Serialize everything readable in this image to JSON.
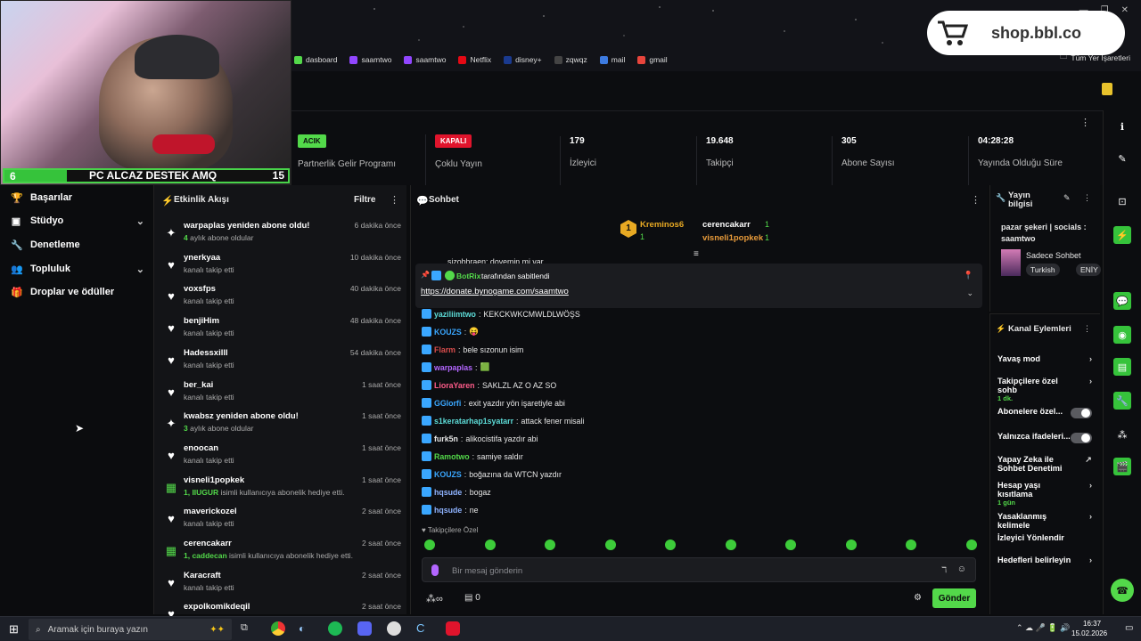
{
  "browser": {
    "bookmarks": [
      {
        "label": "dasboard",
        "color": "#53d94a"
      },
      {
        "label": "saamtwo",
        "color": "#9146ff"
      },
      {
        "label": "saamtwo",
        "color": "#9146ff"
      },
      {
        "label": "Netflix",
        "color": "#e50914"
      },
      {
        "label": "disney+",
        "color": "#1a3a8f"
      },
      {
        "label": "zqwqz",
        "color": "#444"
      },
      {
        "label": "mail",
        "color": "#3d7be0"
      },
      {
        "label": "gmail",
        "color": "#e8453c"
      }
    ],
    "all_bookmarks": "Tüm Yer İşaretleri",
    "shop_text": "shop.bbl.co"
  },
  "overlay": {
    "left": "6",
    "text": "PC ALCAZ DESTEK AMQ",
    "right": "15"
  },
  "stats": [
    {
      "badge": "ACIK",
      "badge_color": "#53d94a",
      "label": "Partnerlik Gelir Programı"
    },
    {
      "badge": "KAPALI",
      "badge_color": "#e0142c",
      "label": "Çoklu Yayın"
    },
    {
      "value": "179",
      "label": "İzleyici"
    },
    {
      "value": "19.648",
      "label": "Takipçi"
    },
    {
      "value": "305",
      "label": "Abone Sayısı"
    },
    {
      "value": "04:28:28",
      "label": "Yayında Olduğu Süre"
    }
  ],
  "nav": [
    {
      "label": "Başarılar",
      "icon": "trophy-icon"
    },
    {
      "label": "Stüdyo",
      "icon": "camera-icon",
      "chevron": true
    },
    {
      "label": "Denetleme",
      "icon": "wrench-icon"
    },
    {
      "label": "Topluluk",
      "icon": "users-icon",
      "chevron": true
    },
    {
      "label": "Droplar ve ödüller",
      "icon": "gift-icon"
    }
  ],
  "activity": {
    "title": "Etkinlik Akışı",
    "filter": "Filtre",
    "items": [
      {
        "name": "warpaplas yeniden abone oldu!",
        "sub_hl": "4",
        "sub": " aylık abone oldular",
        "time": "6 dakika önce",
        "icon": "star"
      },
      {
        "name": "ynerkyaa",
        "sub": "kanalı takip etti",
        "time": "10 dakika önce",
        "icon": "heart"
      },
      {
        "name": "voxsfps",
        "sub": "kanalı takip etti",
        "time": "40 dakika önce",
        "icon": "heart"
      },
      {
        "name": "benjiHim",
        "sub": "kanalı takip etti",
        "time": "48 dakika önce",
        "icon": "heart"
      },
      {
        "name": "Hadessxilll",
        "sub": "kanalı takip etti",
        "time": "54 dakika önce",
        "icon": "heart"
      },
      {
        "name": "ber_kai",
        "sub": "kanalı takip etti",
        "time": "1 saat önce",
        "icon": "heart"
      },
      {
        "name": "kwabsz yeniden abone oldu!",
        "sub_hl": "3",
        "sub": " aylık abone oldular",
        "time": "1 saat önce",
        "icon": "star"
      },
      {
        "name": "enoocan",
        "sub": "kanalı takip etti",
        "time": "1 saat önce",
        "icon": "heart"
      },
      {
        "name": "visneli1popkek",
        "sub_hl": "1, IIUGUR",
        "sub": " isimli kullanıcıya abonelik hediye etti.",
        "time": "1 saat önce",
        "icon": "gift"
      },
      {
        "name": "maverickozel",
        "sub": "kanalı takip etti",
        "time": "2 saat önce",
        "icon": "heart"
      },
      {
        "name": "cerencakarr",
        "sub_hl": "1, caddecan",
        "sub": " isimli kullanıcıya abonelik hediye etti.",
        "time": "2 saat önce",
        "icon": "gift"
      },
      {
        "name": "Karacraft",
        "sub": "kanalı takip etti",
        "time": "2 saat önce",
        "icon": "heart"
      },
      {
        "name": "expolkomikdeqil",
        "sub": "",
        "time": "2 saat önce",
        "icon": "heart"
      }
    ]
  },
  "chat": {
    "title": "Sohbet",
    "leaderboard": [
      {
        "rank": "1",
        "name": "Kreminos6",
        "count": "1",
        "sub": "1"
      },
      {
        "name": "cerencakarr",
        "count": "1"
      },
      {
        "name": "visneli1popkek",
        "count": "1"
      }
    ],
    "partial_top": "sizobhraen: dovemin mi var",
    "pinned": {
      "by": "BotRix",
      "suffix": "tarafından sabitlendi",
      "link": "https://donate.bynogame.com/saamtwo"
    },
    "messages": [
      {
        "user": "yaziliimtwo",
        "color": "#5ddcd8",
        "text": "KEKCKWKCMWLDLWÖŞS"
      },
      {
        "user": "KOUZS",
        "color": "#3aa7ff",
        "text": "😝"
      },
      {
        "user": "Flarm",
        "color": "#d94d4d",
        "text": "bele sızonun isim"
      },
      {
        "user": "warpaplas",
        "color": "#b366ff",
        "text": "🟩"
      },
      {
        "user": "LioraYaren",
        "color": "#ff5c8a",
        "text": "SAKLZL AZ O AZ SO"
      },
      {
        "user": "GGlorfi",
        "color": "#3aa7ff",
        "text": "exit yazdır yön işaretiyle abi"
      },
      {
        "user": "s1keratarhap1syatarr",
        "color": "#5ddcd8",
        "text": "attack fener misali"
      },
      {
        "user": "furk5n",
        "color": "#e6e6e6",
        "text": "alikocistifa yazdır abi"
      },
      {
        "user": "Ramotwo",
        "color": "#53d94a",
        "text": "samiye saldır"
      },
      {
        "user": "KOUZS",
        "color": "#3aa7ff",
        "text": "boğazına da WTCN yazdır"
      },
      {
        "user": "hqsude",
        "color": "#8fb3ff",
        "text": "bogaz"
      },
      {
        "user": "hqsude",
        "color": "#8fb3ff",
        "text": "ne"
      }
    ],
    "emote_label": "Takipçilere Özel",
    "input_placeholder": "Bir mesaj gönderin",
    "count": "0",
    "send": "Gönder"
  },
  "stream_info": {
    "title": "Yayın bilgisi",
    "desc": "pazar şekeri | socials : saamtwo",
    "category": "Sadece Sohbet",
    "tags": [
      "Turkish",
      "ENİY"
    ]
  },
  "channel_actions": {
    "title": "Kanal Eylemleri",
    "items": [
      {
        "label": "Yavaş mod",
        "type": "chev"
      },
      {
        "label": "Takipçilere özel sohb",
        "sub": "1 dk.",
        "type": "chev"
      },
      {
        "label": "Abonelere özel...",
        "type": "toggle"
      },
      {
        "label": "Yalnızca ifadeleri...",
        "type": "toggle"
      },
      {
        "label": "Yapay Zeka ile Sohbet Denetimi",
        "type": "ext"
      },
      {
        "label": "Hesap yaşı kısıtlama",
        "sub": "1 gün",
        "type": "chev"
      },
      {
        "label": "Yasaklanmış kelimele",
        "type": "chev"
      },
      {
        "label": "İzleyici Yönlendir",
        "type": "none"
      },
      {
        "label": "Hedefleri belirleyin",
        "type": "chev"
      }
    ]
  },
  "taskbar": {
    "search": "Aramak için buraya yazın",
    "time": "16:37",
    "date": "15.02.2026"
  }
}
